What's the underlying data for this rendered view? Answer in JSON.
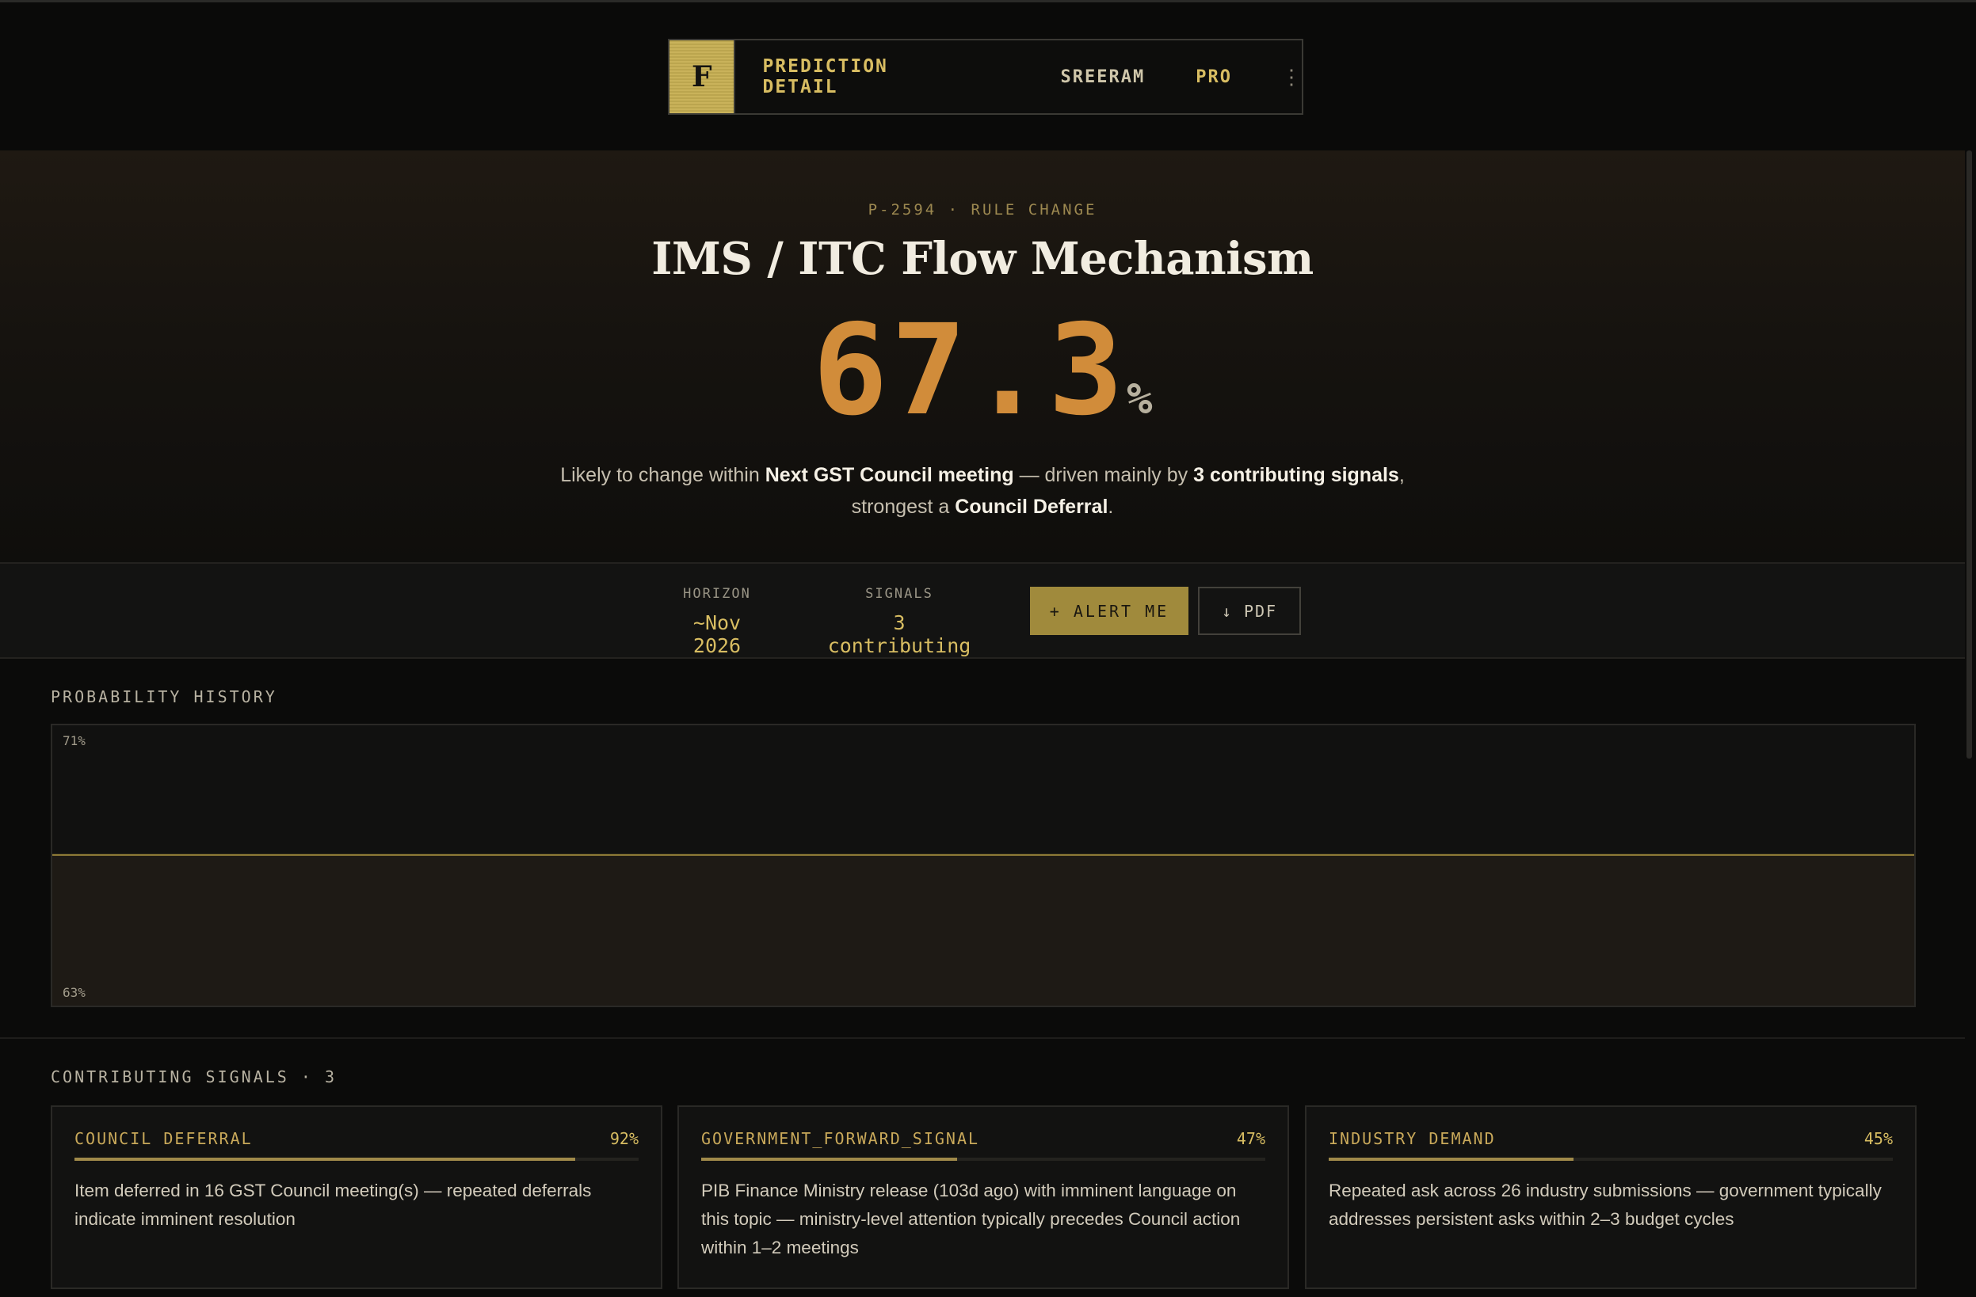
{
  "nav": {
    "logo": "F",
    "title": "PREDICTION DETAIL",
    "user": "SREERAM",
    "plan": "PRO",
    "more_icon": "⋮"
  },
  "hero": {
    "kicker": "P-2594 · RULE CHANGE",
    "title": "IMS / ITC Flow Mechanism",
    "probability": "67.3",
    "percent_sign": "%",
    "desc_1": "Likely to change within ",
    "desc_b1": "Next GST Council meeting",
    "desc_2": " — driven mainly by ",
    "desc_b2": "3 contributing signals",
    "desc_3": ",",
    "desc_4": "strongest a ",
    "desc_b3": "Council Deferral",
    "desc_5": "."
  },
  "stats": {
    "horizon_label": "HORIZON",
    "horizon_value": "~Nov 2026",
    "signals_label": "SIGNALS",
    "signals_value": "3 contributing",
    "alert_button": "+ ALERT ME",
    "pdf_button": "↓ PDF"
  },
  "history": {
    "label": "PROBABILITY HISTORY",
    "y_max_label": "71%",
    "y_min_label": "63%"
  },
  "chart_data": {
    "type": "area",
    "title": "PROBABILITY HISTORY",
    "ylim": [
      63,
      71
    ],
    "series": [
      {
        "values": [
          67.3,
          67.3
        ]
      }
    ],
    "grid": false
  },
  "signals": {
    "label": "CONTRIBUTING SIGNALS · 3",
    "items": [
      {
        "name": "COUNCIL DEFERRAL",
        "pct_label": "92%",
        "weight": 0.92,
        "text": "Item deferred in 16 GST Council meeting(s) — repeated deferrals indicate imminent resolution"
      },
      {
        "name": "GOVERNMENT_FORWARD_SIGNAL",
        "pct_label": "47%",
        "weight": 0.47,
        "text": "PIB Finance Ministry release (103d ago) with imminent language on this topic — ministry-level attention typically precedes Council action within 1–2 meetings"
      },
      {
        "name": "INDUSTRY DEMAND",
        "pct_label": "45%",
        "weight": 0.45,
        "text": "Repeated ask across 26 industry submissions — government typically addresses persistent asks within 2–3 budget cycles"
      }
    ]
  },
  "colors": {
    "accent": "#d8bd62",
    "probability": "#d18c3a",
    "line": "#a08a3c"
  }
}
